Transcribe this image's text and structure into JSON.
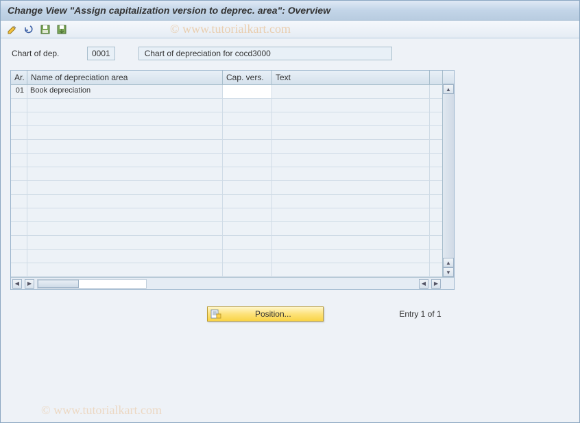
{
  "title": "Change View \"Assign capitalization version to deprec. area\": Overview",
  "watermark": "© www.tutorialkart.com",
  "toolbar_icons": [
    "edit",
    "undo",
    "save",
    "save-to"
  ],
  "fields": {
    "chart_of_dep_label": "Chart of dep.",
    "chart_of_dep_value": "0001",
    "chart_of_dep_desc": "Chart of depreciation for cocd3000"
  },
  "grid": {
    "headers": {
      "a": "Ar.",
      "b": "Name of depreciation area",
      "c": "Cap. vers.",
      "d": "Text"
    },
    "rows": [
      {
        "a": "01",
        "b": "Book depreciation",
        "c": "",
        "d": ""
      }
    ],
    "empty_row_count": 13
  },
  "footer": {
    "position_label": "Position...",
    "entry_text": "Entry 1 of 1"
  }
}
